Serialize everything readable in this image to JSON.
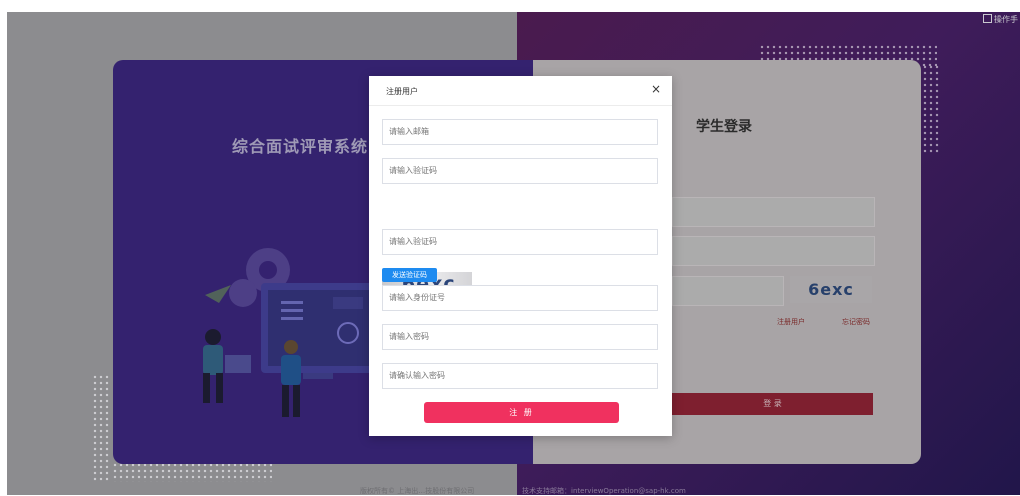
{
  "header": {
    "top_right_link": "操作手"
  },
  "left_panel": {
    "system_title": "综合面试评审系统"
  },
  "login": {
    "title": "学生登录",
    "captcha_text": "6exc",
    "register_link": "注册用户",
    "forgot_link": "忘记密码",
    "login_button": "登 录"
  },
  "register_modal": {
    "title": "注册用户",
    "close_label": "×",
    "email_placeholder": "请输入邮箱",
    "code_placeholder_1": "请输入验证码",
    "captcha_text": "6exc",
    "code_placeholder_2": "请输入验证码",
    "send_code_button": "发送验证码",
    "id_placeholder": "请输入身份证号",
    "password_placeholder": "请输入密码",
    "confirm_password_placeholder": "请确认输入密码",
    "register_button": "注 册"
  },
  "footer": {
    "copyright": "版权所有© 上海出…技股份有限公司",
    "support": "技术支持邮箱：interviewOperation@sap-hk.com"
  },
  "colors": {
    "overlay_left": "#8c8c8f",
    "overlay_right": "#3f1c5a",
    "left_card": "#34226f",
    "send_button": "#1e8bf0",
    "register_button": "#f0315f"
  }
}
